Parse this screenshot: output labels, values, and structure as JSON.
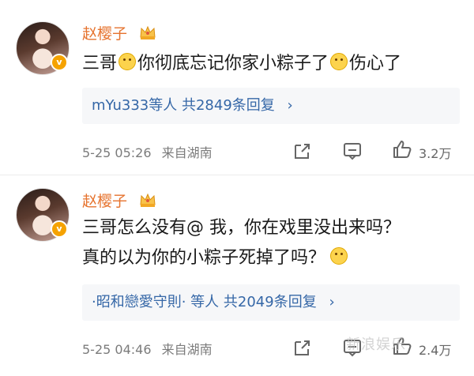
{
  "comments": [
    {
      "name": "赵樱子",
      "text_parts": [
        "三哥",
        "你彻底忘记你家小粽子了",
        "伤心了"
      ],
      "replies": {
        "users": "mYu333等人",
        "count": "共2849条回复",
        "chevron": "›"
      },
      "meta": {
        "date": "5-25 05:26",
        "source": "来自湖南"
      },
      "likes": "3.2万"
    },
    {
      "name": "赵樱子",
      "lines": [
        "三哥怎么没有@ 我，你在戏里没出来吗？",
        "真的以为你的小粽子死掉了吗？"
      ],
      "replies": {
        "users": "·昭和戀愛守則· 等人",
        "count": "共2049条回复",
        "chevron": "›"
      },
      "meta": {
        "date": "5-25 04:46",
        "source": "来自湖南"
      },
      "likes": "2.4万"
    }
  ],
  "watermark": "新浪娱乐",
  "colors": {
    "name": "#e6732e",
    "link": "#3567a7",
    "badge": "#f5a200"
  },
  "icons": [
    "crown-icon",
    "share-icon",
    "comment-icon",
    "like-icon",
    "verified-icon"
  ]
}
